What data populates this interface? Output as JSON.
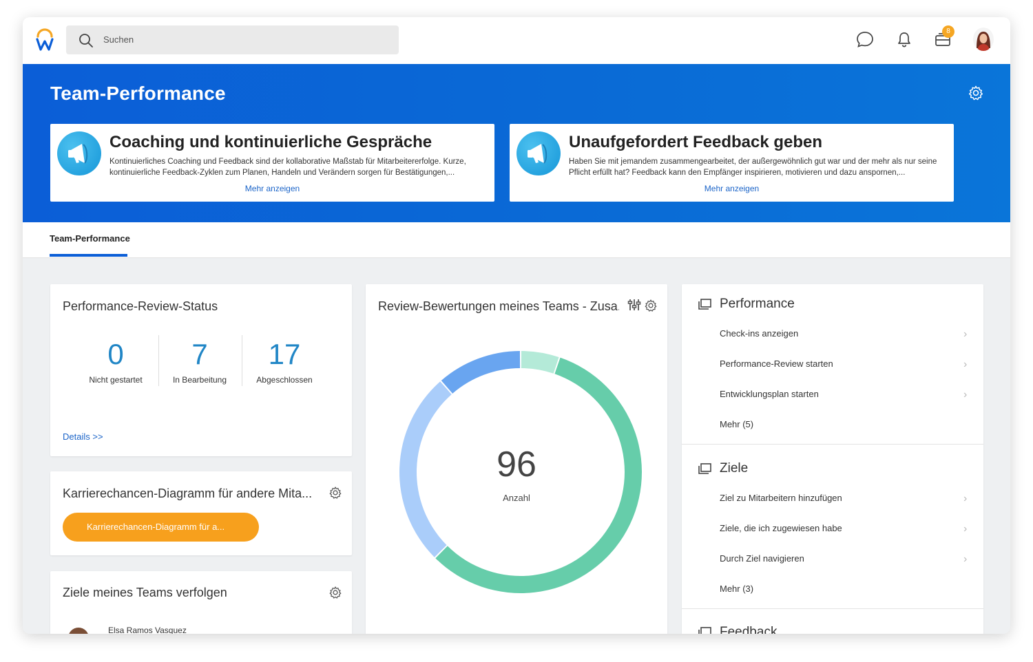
{
  "topbar": {
    "search_placeholder": "Suchen",
    "notification_count": "8"
  },
  "hero": {
    "title": "Team-Performance",
    "promos": [
      {
        "title": "Coaching und kontinuierliche Gespräche",
        "description": "Kontinuierliches Coaching und Feedback sind der kollaborative Maßstab für Mitarbeitererfolge. Kurze, kontinuierliche Feedback-Zyklen zum Planen, Handeln und Verändern sorgen für Bestätigungen,...",
        "more": "Mehr anzeigen"
      },
      {
        "title": "Unaufgefordert Feedback geben",
        "description": "Haben Sie mit jemandem zusammengearbeitet, der außergewöhnlich gut war und der mehr als nur seine Pflicht erfüllt hat? Feedback kann den Empfänger inspirieren, motivieren und dazu anspornen,...",
        "more": "Mehr anzeigen"
      }
    ]
  },
  "tabs": [
    {
      "label": "Team-Performance",
      "active": true
    }
  ],
  "review_status": {
    "title": "Performance-Review-Status",
    "stats": [
      {
        "value": "0",
        "label": "Nicht gestartet"
      },
      {
        "value": "7",
        "label": "In Bearbeitung"
      },
      {
        "value": "17",
        "label": "Abgeschlossen"
      }
    ],
    "details_link": "Details >>"
  },
  "career_chart": {
    "title": "Karrierechancen-Diagramm für andere Mita...",
    "button_label": "Karrierechancen-Diagramm für a..."
  },
  "team_goals": {
    "title": "Ziele meines Teams verfolgen",
    "first_person": "Elsa Ramos Vasquez"
  },
  "ratings": {
    "title": "Review-Bewertungen meines Teams - Zusa...",
    "total": "96",
    "total_label": "Anzahl"
  },
  "chart_data": {
    "type": "pie",
    "variant": "donut",
    "segments": [
      {
        "value": 5,
        "color": "#b4ead8"
      },
      {
        "value": 55,
        "color": "#66cdaa"
      },
      {
        "value": 25,
        "color": "#aacdfa"
      },
      {
        "value": 11,
        "color": "#69a5f0"
      }
    ],
    "total": 96,
    "center_label": "Anzahl"
  },
  "actions": {
    "sections": [
      {
        "title": "Performance",
        "items": [
          "Check-ins anzeigen",
          "Performance-Review starten",
          "Entwicklungsplan starten",
          "Mehr (5)"
        ]
      },
      {
        "title": "Ziele",
        "items": [
          "Ziel zu Mitarbeitern hinzufügen",
          "Ziele, die ich zugewiesen habe",
          "Durch Ziel navigieren",
          "Mehr (3)"
        ]
      },
      {
        "title": "Feedback",
        "items": []
      }
    ]
  },
  "colors": {
    "brand_blue": "#0b5ed7",
    "stat_blue": "#2186c6",
    "link_blue": "#1b64c8",
    "orange": "#f7a01d",
    "badge": "#f5a623"
  }
}
